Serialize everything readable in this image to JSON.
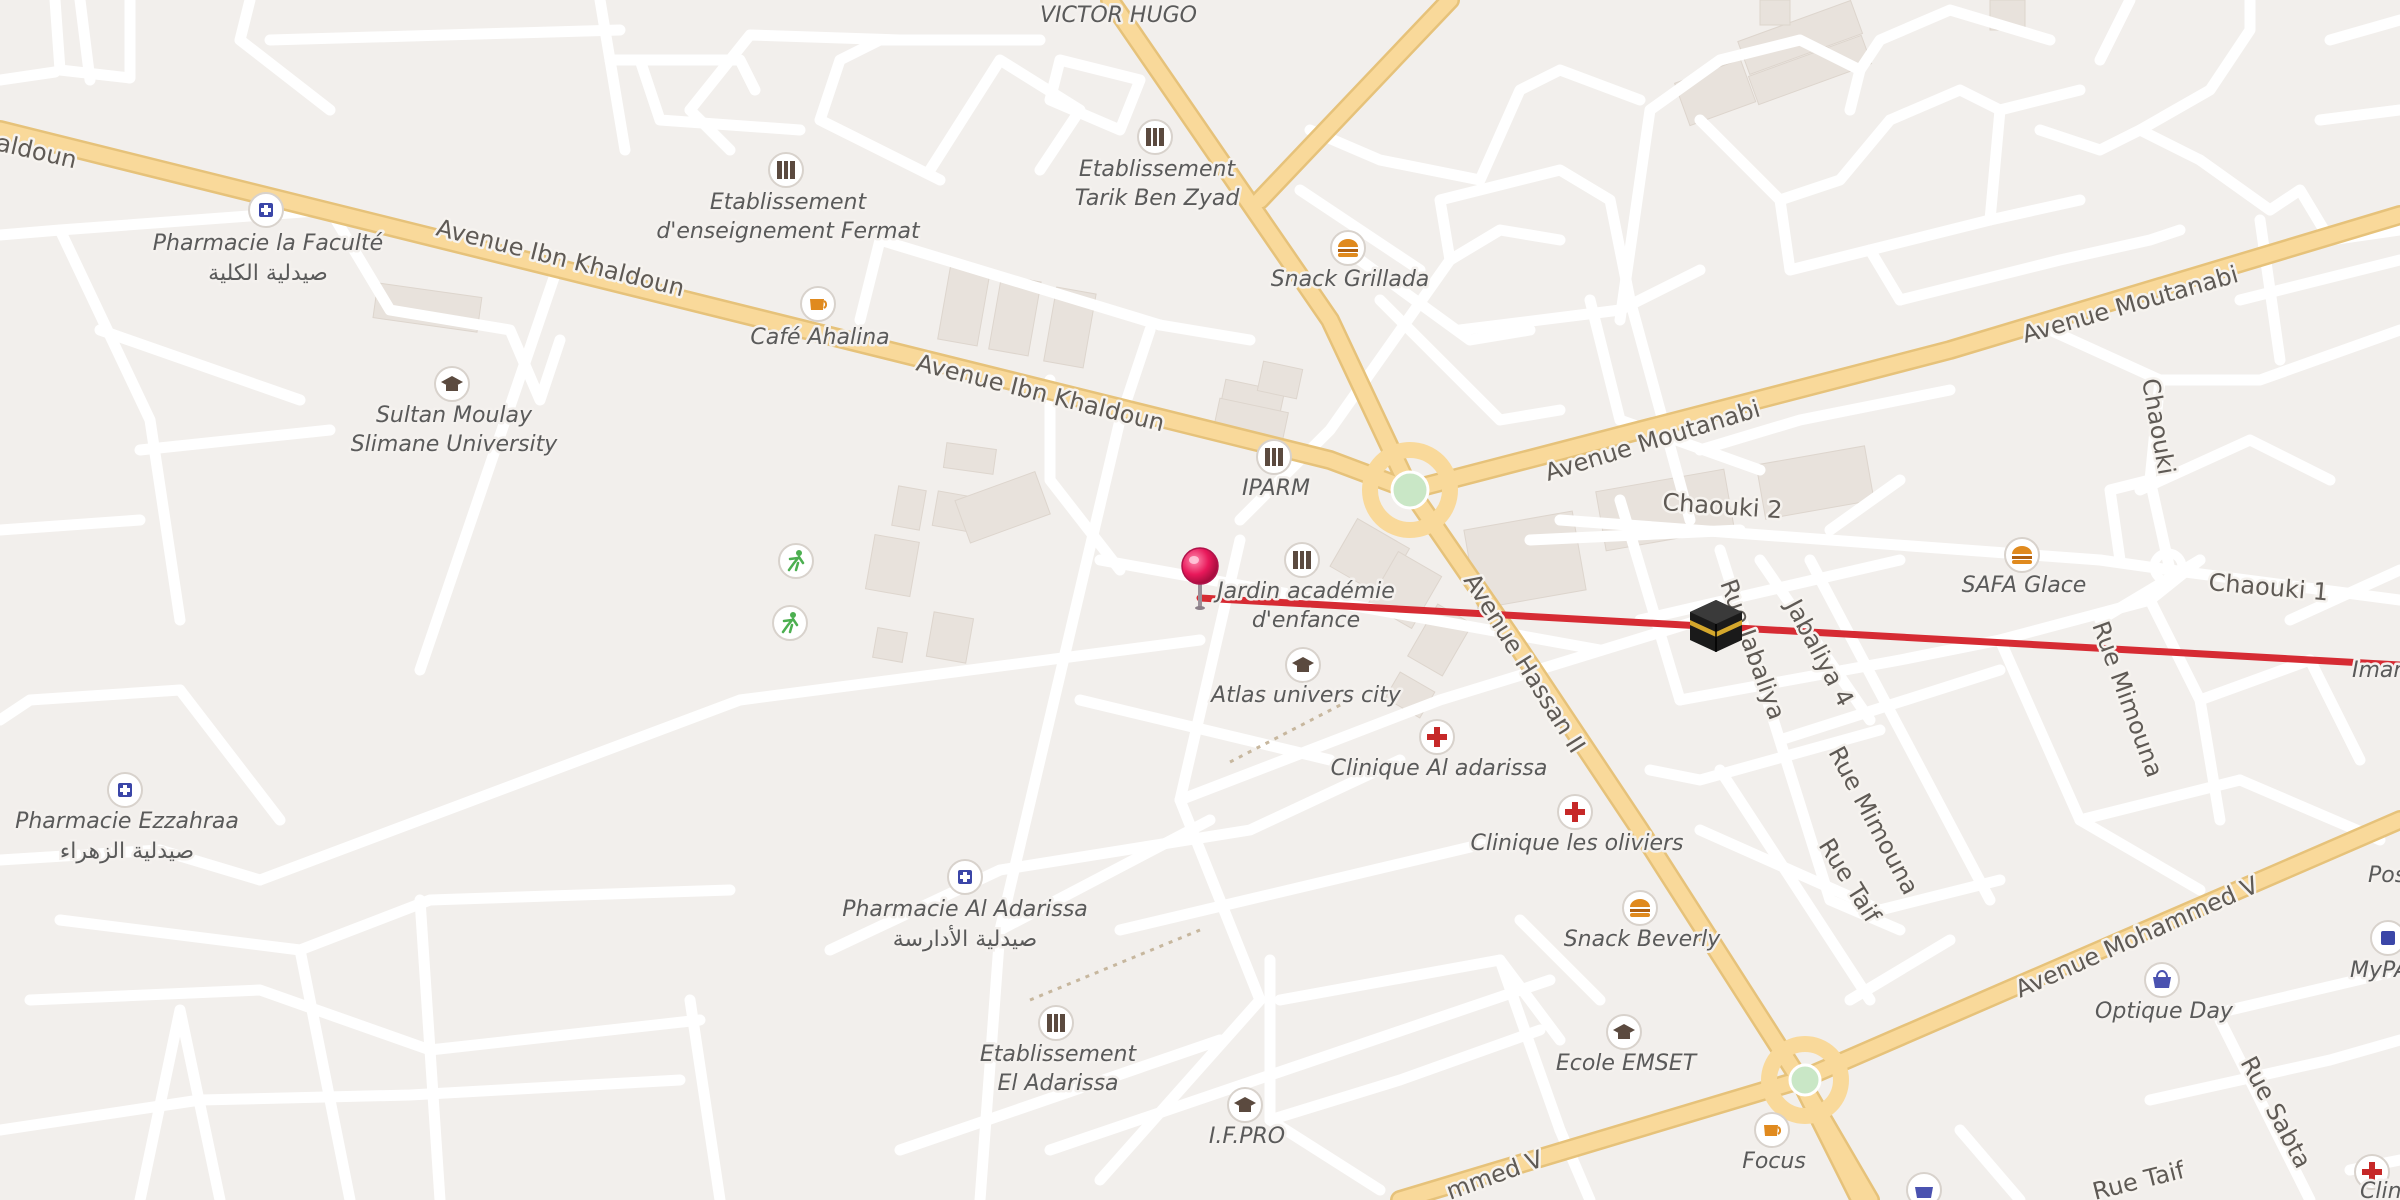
{
  "map": {
    "route_color": "#d62b33",
    "pin_color": "#e8185a",
    "road_minor_color": "#ffffff",
    "road_major_color": "#f7d48a",
    "background_color": "#f2efec",
    "kaaba_icon": "kaaba-icon"
  },
  "streets": {
    "ibn_khaldoun_1": "Avenue Ibn Khaldoun",
    "ibn_khaldoun_2": "Avenue Ibn Khaldoun",
    "ibn_khaldoun_edge": "aldoun",
    "victor_hugo": "VICTOR HUGO",
    "moutanabi_1": "Avenue Moutanabi",
    "moutanabi_2": "Avenue Moutanabi",
    "chaouki_2": "Chaouki 2",
    "chaouki_1": "Chaouki 1",
    "chaouki": "Chaouki",
    "hassan_ii": "Avenue Hassan II",
    "mohammed_v_1": "Avenue Mohammed V",
    "mohammed_v_2": "mmed V",
    "jabaliya": "Rue Jabaliya",
    "jabaliya_4": "Jabaliya 4",
    "mimouna_1": "Rue Mimouna",
    "mimouna_2": "Rue Mimouna",
    "taif_1": "Rue Taif",
    "taif_2": "Rue Taif",
    "sabta": "Rue Sabta",
    "imam_edge": "Imam"
  },
  "pois": {
    "pharmacie_faculte": {
      "name": "Pharmacie la Faculté",
      "arabic": "صيدلية الكلية",
      "icon": "pharmacy-icon"
    },
    "fermat": {
      "line1": "Etablissement",
      "line2": "d'enseignement Fermat",
      "icon": "school-icon"
    },
    "tarik": {
      "line1": "Etablissement",
      "line2": "Tarik Ben Zyad",
      "icon": "school-icon"
    },
    "snack_grillada": {
      "name": "Snack Grillada",
      "icon": "fast-food-icon"
    },
    "cafe_ahalina": {
      "name": "Café Ahalina",
      "icon": "cafe-icon"
    },
    "sultan": {
      "line1": "Sultan Moulay",
      "line2": "Slimane University",
      "icon": "university-icon"
    },
    "iparm": {
      "name": "IPARM",
      "icon": "school-icon"
    },
    "jardin": {
      "line1": "Jardin académie",
      "line2": "d'enfance",
      "icon": "school-icon"
    },
    "atlas": {
      "name": "Atlas univers city",
      "icon": "university-icon"
    },
    "clinique_adarissa": {
      "name": "Clinique Al adarissa",
      "icon": "hospital-icon"
    },
    "clinique_oliviers": {
      "name": "Clinique les oliviers",
      "icon": "hospital-icon"
    },
    "safa": {
      "name": "SAFA Glace",
      "icon": "fast-food-icon"
    },
    "pharmacie_ezzahraa": {
      "name": "Pharmacie Ezzahraa",
      "arabic": "صيدلية الزهراء",
      "icon": "pharmacy-icon"
    },
    "pharmacie_adarissa": {
      "name": "Pharmacie Al Adarissa",
      "arabic": "صيدلية الأدارسة",
      "icon": "pharmacy-icon"
    },
    "snack_beverly": {
      "name": "Snack Beverly",
      "icon": "fast-food-icon"
    },
    "el_adarissa": {
      "line1": "Etablissement",
      "line2": "El Adarissa",
      "icon": "school-icon"
    },
    "emset": {
      "name": "Ecole EMSET",
      "icon": "university-icon"
    },
    "ifpro": {
      "name": "I.F.PRO",
      "icon": "university-icon"
    },
    "focus": {
      "name": "Focus",
      "icon": "cafe-icon"
    },
    "optique_day": {
      "name": "Optique Day",
      "icon": "shop-icon"
    },
    "post_edge": {
      "name": "Pos"
    },
    "mypa_edge": {
      "name": "MyPA",
      "icon": "pharmacy-icon"
    },
    "clinic_edge": {
      "name": "Clini"
    },
    "sport1": {
      "icon": "sport-icon"
    },
    "sport2": {
      "icon": "sport-icon"
    }
  }
}
